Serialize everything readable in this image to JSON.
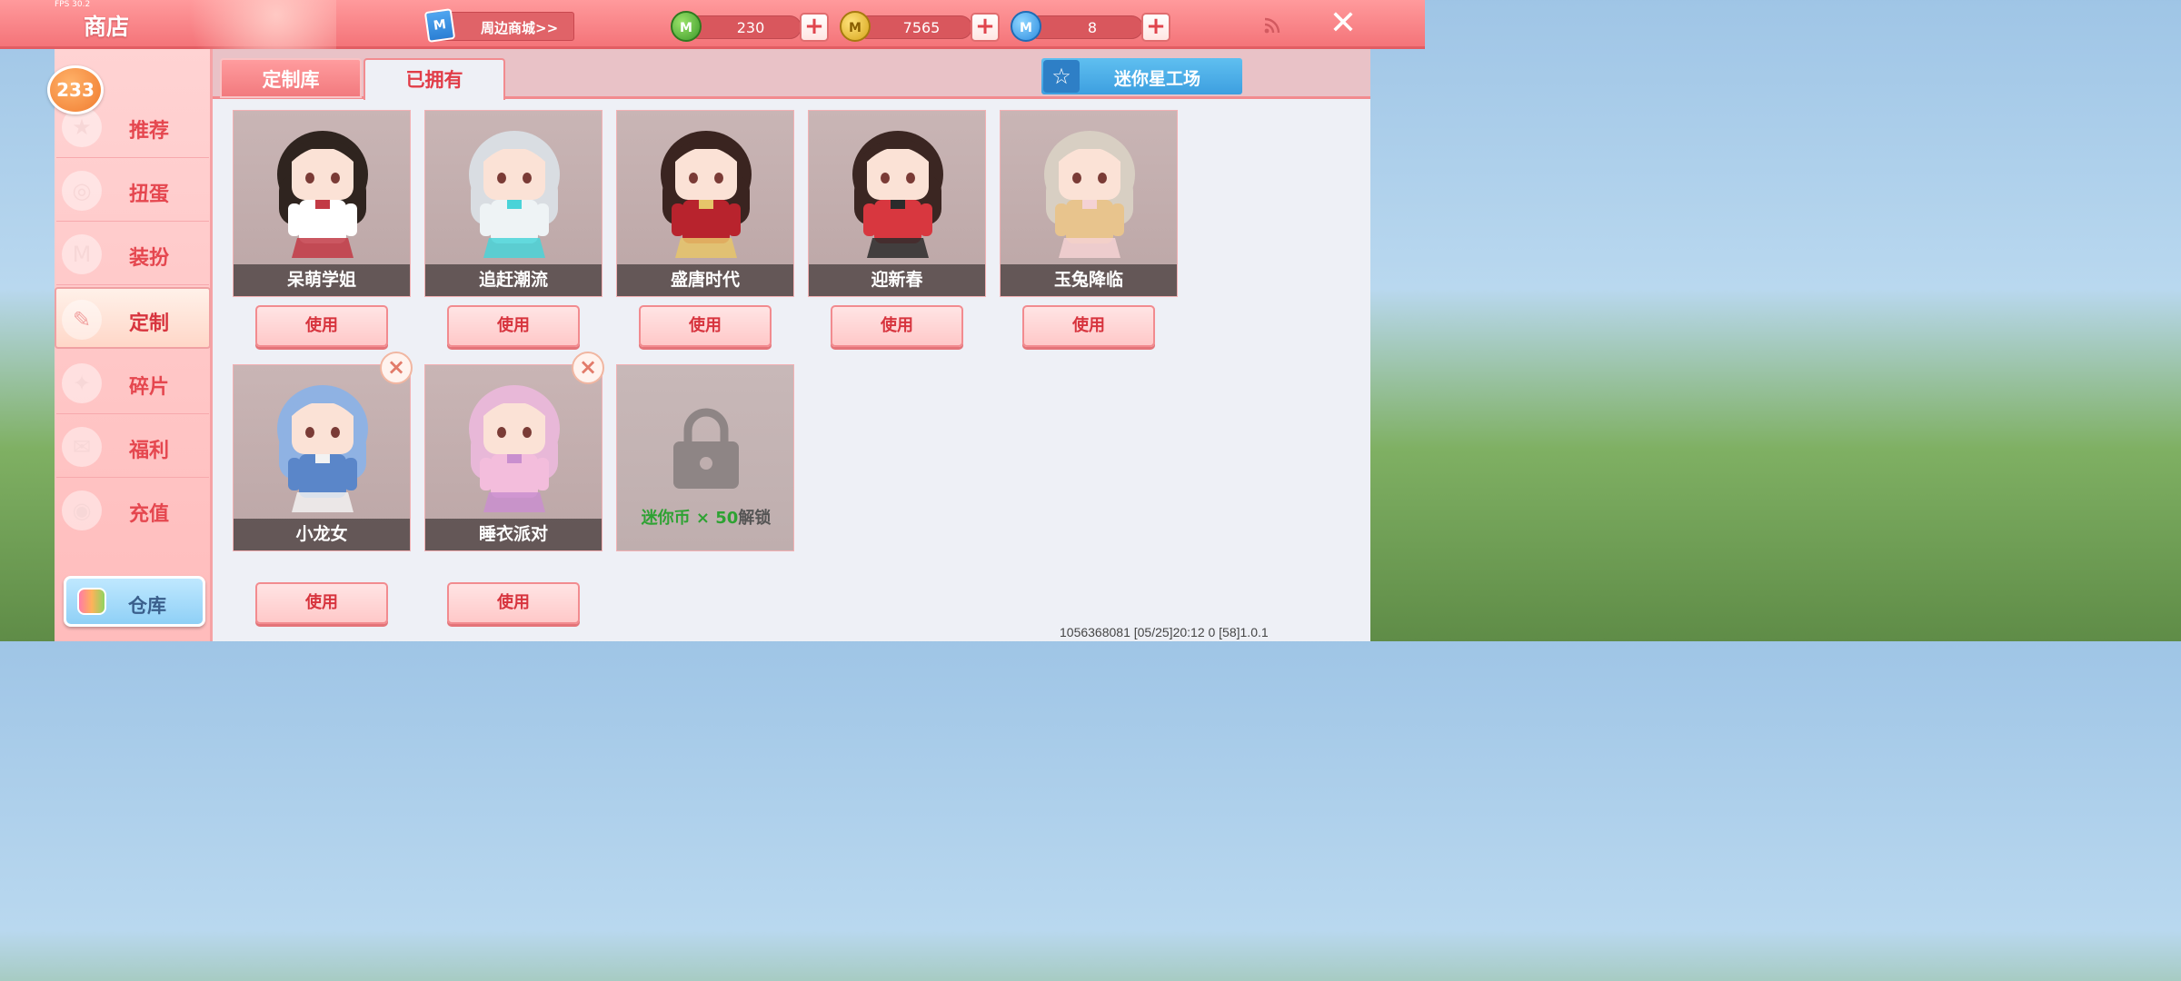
{
  "window": {
    "fps": "FPS 30.2",
    "title": "商店"
  },
  "mall": {
    "icon": "M",
    "label": "周边商城>>"
  },
  "currencies": [
    {
      "icon": "green-mini-bean-icon",
      "value": "230"
    },
    {
      "icon": "gold-mini-coin-icon",
      "value": "7565"
    },
    {
      "icon": "blue-mini-point-icon",
      "value": "8"
    }
  ],
  "sidebar": {
    "badge": "233",
    "items": [
      {
        "label": "推荐"
      },
      {
        "label": "扭蛋"
      },
      {
        "label": "装扮"
      },
      {
        "label": "定制",
        "active": true
      },
      {
        "label": "碎片"
      },
      {
        "label": "福利"
      },
      {
        "label": "充值"
      }
    ],
    "warehouse": "仓库"
  },
  "tabs": [
    {
      "label": "定制库"
    },
    {
      "label": "已拥有",
      "active": true
    }
  ],
  "workshop": {
    "label": "迷你星工场"
  },
  "outfits": [
    {
      "name": "呆萌学姐",
      "button": "使用",
      "hair": "#2f241f",
      "outfit": "#ffffff",
      "accent": "#c23a45"
    },
    {
      "name": "追赶潮流",
      "button": "使用",
      "hair": "#d9dde2",
      "outfit": "#eef3f5",
      "accent": "#49d3d8"
    },
    {
      "name": "盛唐时代",
      "button": "使用",
      "hair": "#3a2420",
      "outfit": "#b8232d",
      "accent": "#e6c56a"
    },
    {
      "name": "迎新春",
      "button": "使用",
      "hair": "#3b2622",
      "outfit": "#d8373f",
      "accent": "#2b2b2b"
    },
    {
      "name": "玉兔降临",
      "button": "使用",
      "hair": "#d8cfc3",
      "outfit": "#e8c48d",
      "accent": "#f4d2d4"
    },
    {
      "name": "小龙女",
      "button": "使用",
      "hair": "#8fb2e3",
      "outfit": "#5a86c9",
      "accent": "#f2f2f2",
      "removable": true
    },
    {
      "name": "睡衣派对",
      "button": "使用",
      "hair": "#e8b8d8",
      "outfit": "#f3bddc",
      "accent": "#c98fcf",
      "removable": true
    }
  ],
  "locked_slot": {
    "currency": "迷你币",
    "multiplier": " × 50",
    "action": "解锁"
  },
  "footer": {
    "info": "1056368081   [05/25]20:12 0  [58]1.0.1"
  }
}
